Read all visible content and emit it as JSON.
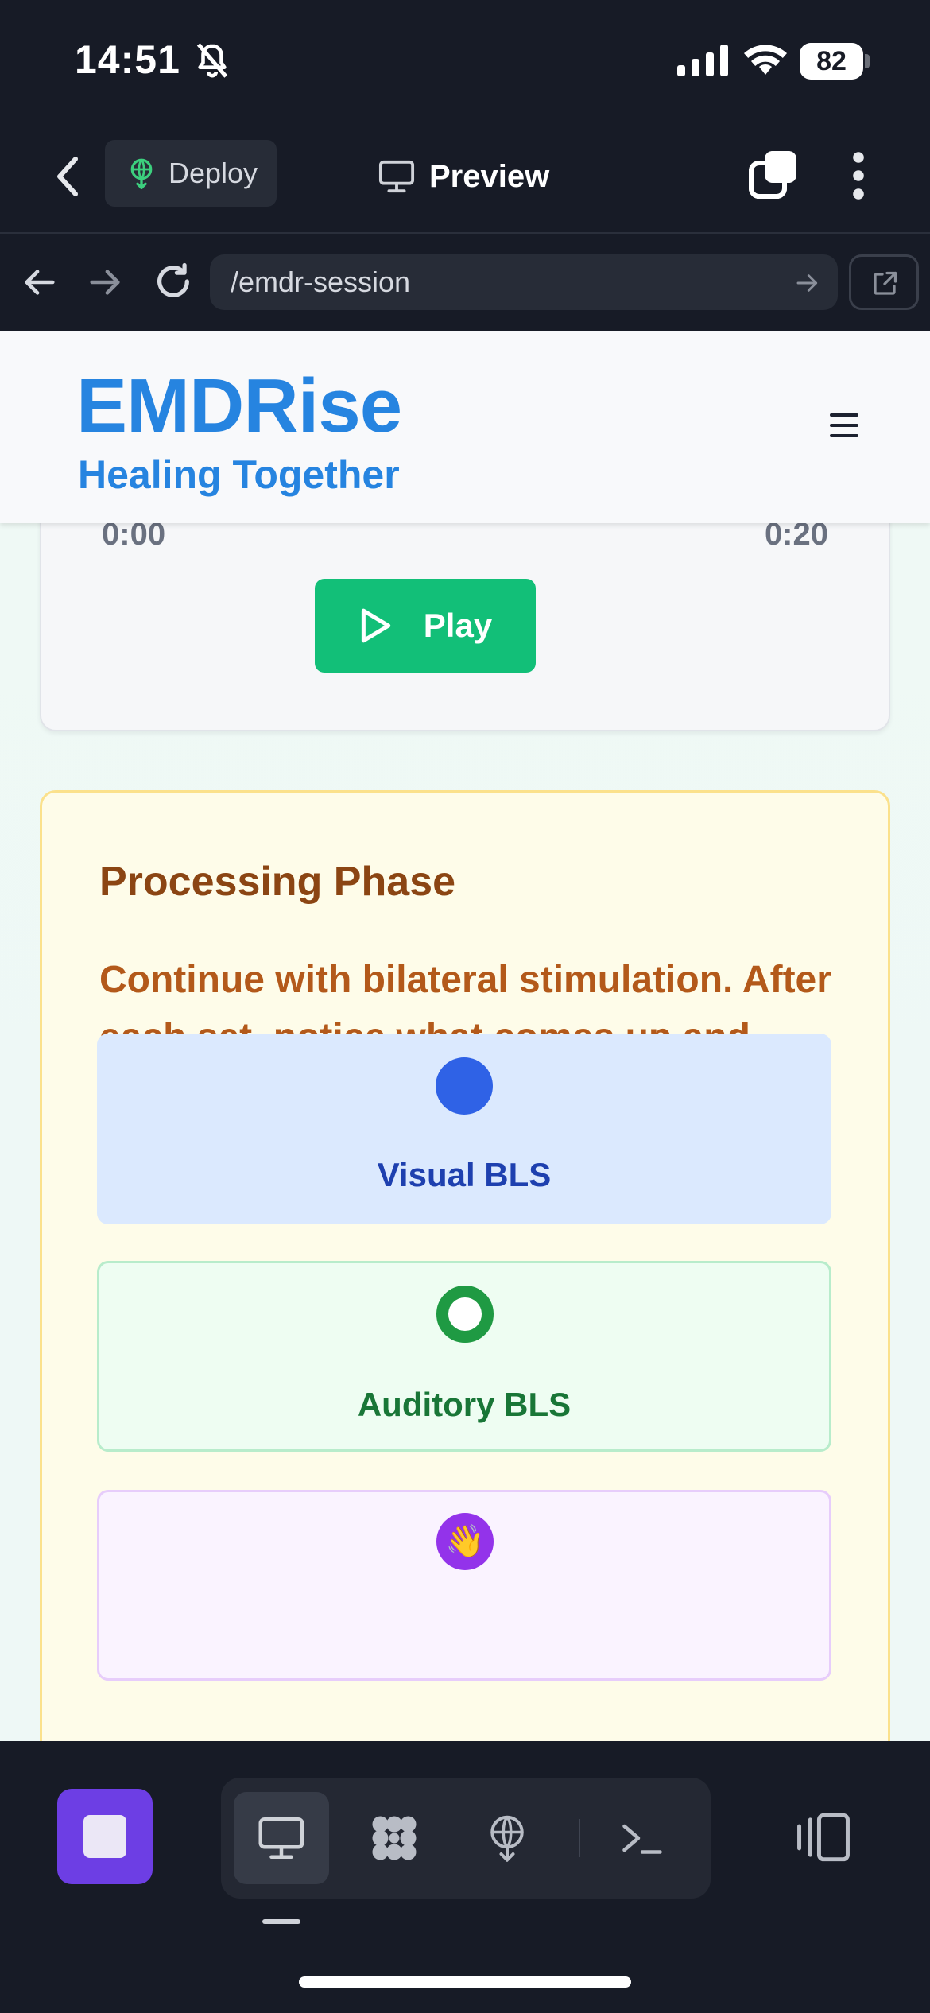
{
  "status_bar": {
    "time": "14:51",
    "battery": "82"
  },
  "app_bar": {
    "deploy_label": "Deploy",
    "preview_label": "Preview"
  },
  "url_bar": {
    "url": "/emdr-session"
  },
  "site": {
    "brand_name": "EMDRise",
    "tagline": "Healing Together"
  },
  "player": {
    "time_start": "0:00",
    "time_end": "0:20",
    "play_label": "Play"
  },
  "phase": {
    "title": "Processing Phase",
    "description": "Continue with bilateral stimulation. After each set, notice what comes up and share if needed.",
    "options": [
      {
        "label": "Visual BLS",
        "icon": "blue-dot-icon"
      },
      {
        "label": "Auditory BLS",
        "icon": "green-ring-icon"
      },
      {
        "label": "",
        "icon": "waving-hand-icon",
        "glyph": "👋"
      }
    ]
  },
  "colors": {
    "brand": "#2684e0",
    "play_button": "#12bf78",
    "stop_button": "#6d3ee4",
    "phase_title": "#8b4513"
  }
}
